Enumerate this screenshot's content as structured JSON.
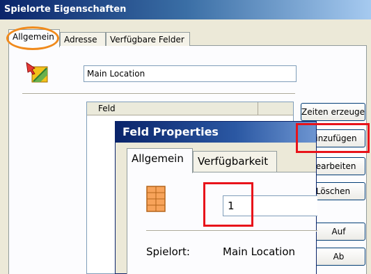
{
  "window": {
    "title": "Spielorte Eigenschaften"
  },
  "tabs": [
    "Allgemein",
    "Adresse",
    "Verfügbare Felder"
  ],
  "location_name": "Main Location",
  "list": {
    "header": "Feld"
  },
  "buttons": {
    "zeiten": "Zeiten erzeugen",
    "hinzufuegen": "Hinzufügen",
    "bearbeiten": "Bearbeiten",
    "loeschen": "Löschen",
    "auf": "Auf",
    "ab": "Ab"
  },
  "dialog": {
    "title": "Feld Properties",
    "tabs": [
      "Allgemein",
      "Verfügbarkeit"
    ],
    "field_value": "1",
    "spielort_label": "Spielort:",
    "spielort_value": "Main Location"
  },
  "icons": {
    "location": "location-arrow-icon",
    "field": "field-grid-icon"
  },
  "highlight_colors": {
    "circle": "#f08a1c",
    "box": "#e8131a"
  }
}
